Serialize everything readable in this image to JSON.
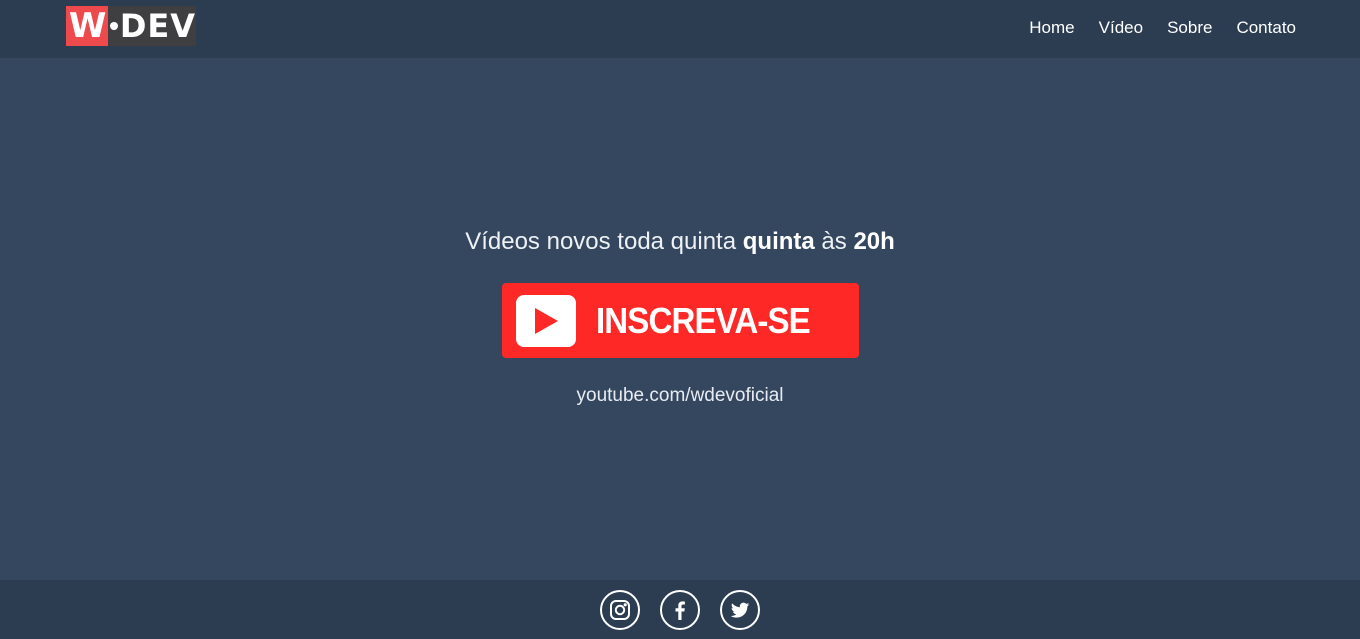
{
  "header": {
    "logo": {
      "w": "W",
      "dev": "DEV"
    },
    "nav": [
      {
        "label": "Home"
      },
      {
        "label": "Vídeo"
      },
      {
        "label": "Sobre"
      },
      {
        "label": "Contato"
      }
    ]
  },
  "main": {
    "headline": {
      "part1": "Vídeos novos toda quinta ",
      "bold1": "quinta",
      "part2": " às ",
      "bold2": "20h"
    },
    "subscribe_label": "INSCREVA-SE",
    "channel_link": "youtube.com/wdevoficial"
  },
  "footer": {
    "social": [
      {
        "icon": "instagram-icon"
      },
      {
        "icon": "facebook-icon"
      },
      {
        "icon": "twitter-icon"
      }
    ]
  },
  "colors": {
    "navbar": "#2c3d52",
    "background": "#34475f",
    "logo_red": "#ee4a4d",
    "subscribe_red": "#fe2826"
  }
}
